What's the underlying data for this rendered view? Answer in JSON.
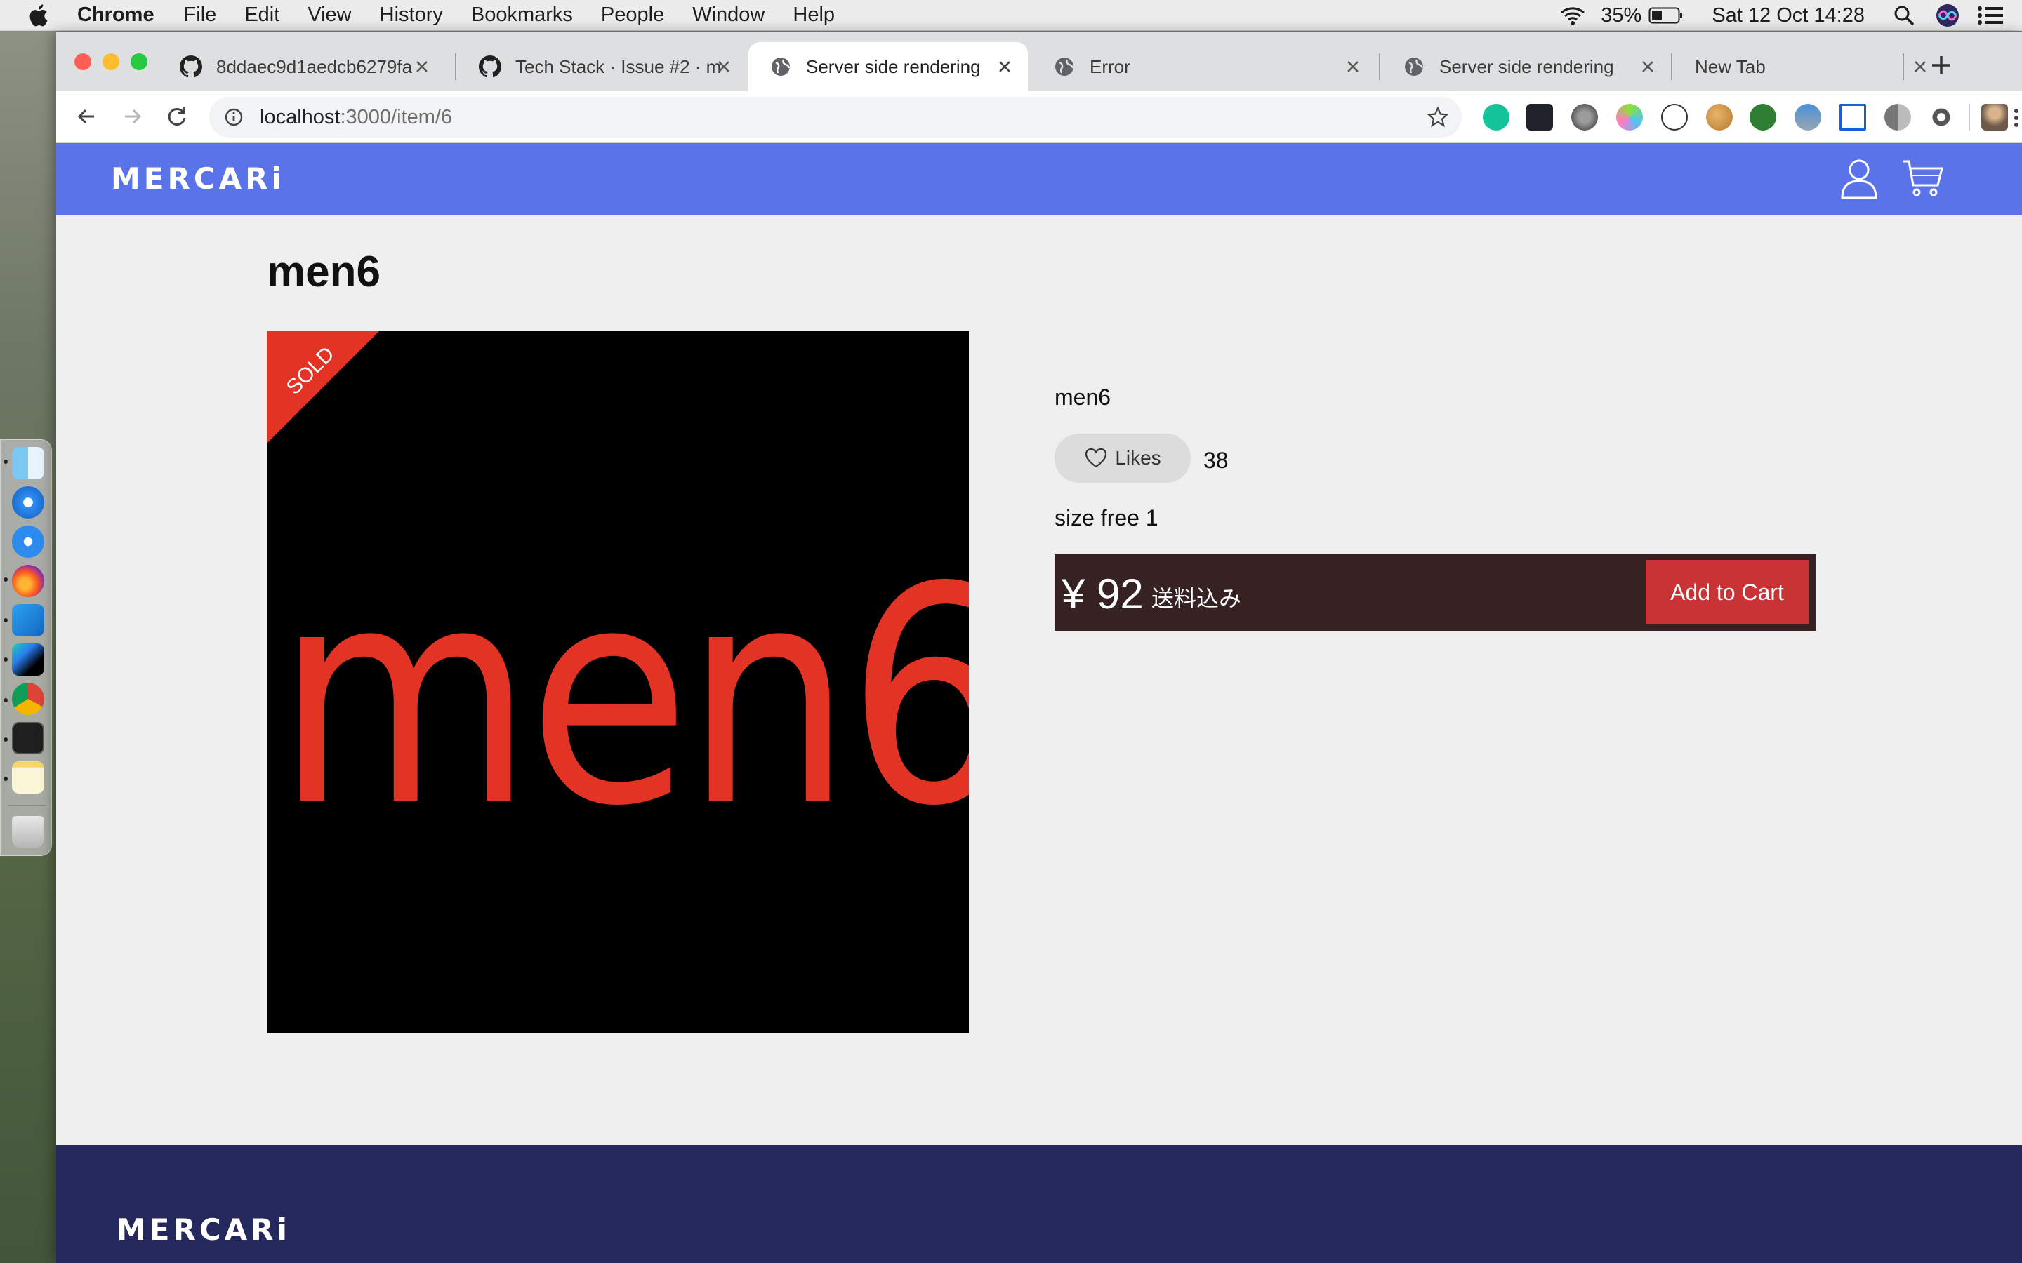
{
  "menubar": {
    "app_name": "Chrome",
    "items": [
      "File",
      "Edit",
      "View",
      "History",
      "Bookmarks",
      "People",
      "Window",
      "Help"
    ],
    "battery": "35%",
    "datetime": "Sat 12 Oct  14:28"
  },
  "browser": {
    "tabs": [
      {
        "label": "8ddaec9d1aedcb6279fa",
        "icon": "github-icon"
      },
      {
        "label": "Tech Stack · Issue #2 · m",
        "icon": "github-icon"
      },
      {
        "label": "Server side rendering",
        "icon": "globe-icon",
        "active": true
      },
      {
        "label": "Error",
        "icon": "globe-icon"
      },
      {
        "label": "Server side rendering",
        "icon": "globe-icon"
      },
      {
        "label": "New Tab",
        "icon": ""
      }
    ],
    "url_host": "localhost",
    "url_path": ":3000/item/6"
  },
  "site": {
    "logo": "MERCARi",
    "brand_color": "#5b73e8",
    "footer_color": "#25285c"
  },
  "item": {
    "title": "men6",
    "image_text": "men6",
    "sold_label": "SOLD",
    "name": "men6",
    "likes_label": "Likes",
    "likes_count": "38",
    "size": "size free 1",
    "price": "¥ 92",
    "shipping": "送料込み",
    "add_to_cart": "Add to Cart"
  },
  "colors": {
    "sold_red": "#e33325",
    "price_bar": "#362222",
    "cart_button": "#c93335"
  }
}
